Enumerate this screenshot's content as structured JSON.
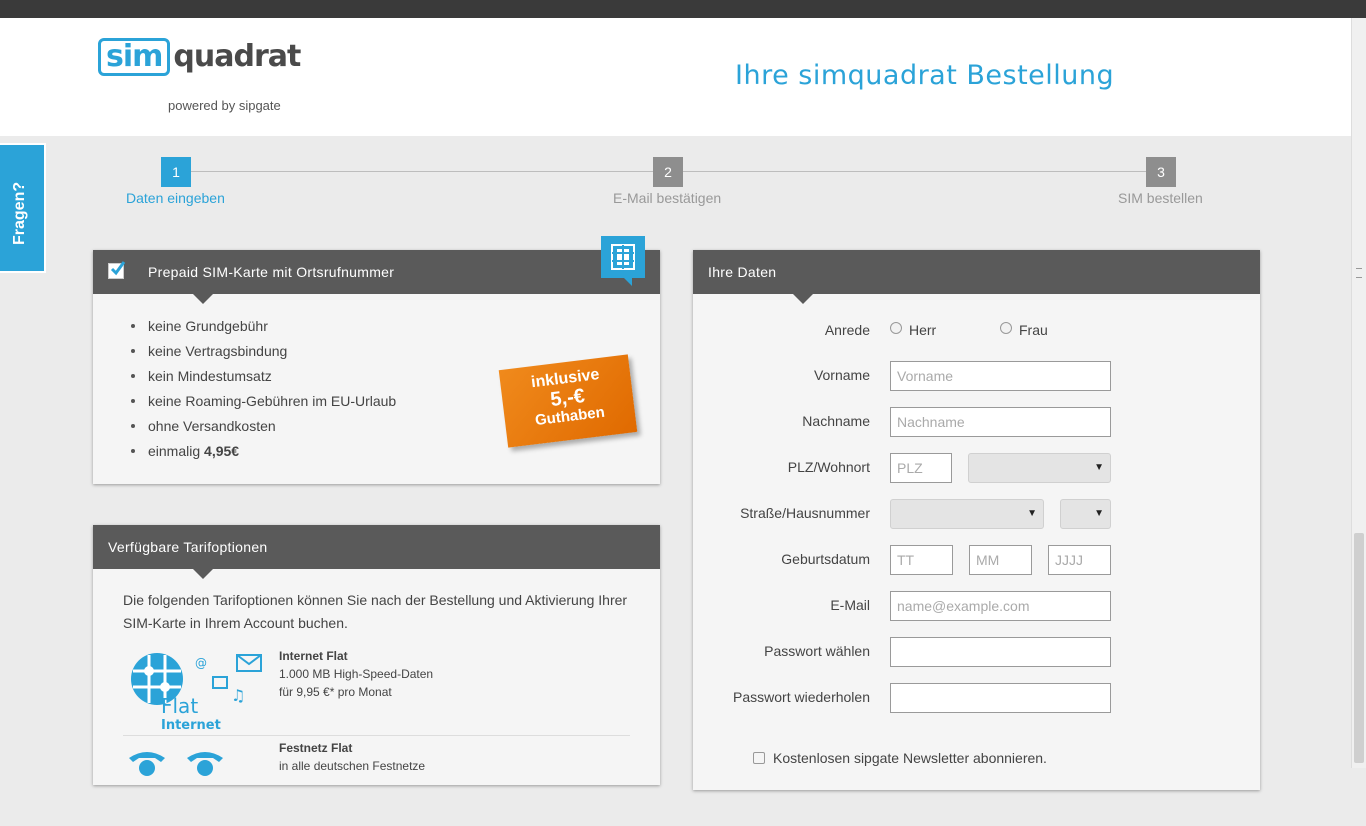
{
  "header": {
    "logo_box": "sim",
    "logo_rest": "quadrat",
    "logo_sub": "powered by sipgate",
    "title": "Ihre simquadrat Bestellung"
  },
  "fragen_tab": "Fragen?",
  "steps": [
    {
      "num": "1",
      "label": "Daten eingeben",
      "active": true
    },
    {
      "num": "2",
      "label": "E-Mail bestätigen",
      "active": false
    },
    {
      "num": "3",
      "label": "SIM bestellen",
      "active": false
    }
  ],
  "sim_panel": {
    "title": "Prepaid SIM-Karte mit Ortsrufnummer",
    "features": [
      "keine Grundgebühr",
      "keine Vertragsbindung",
      "kein Mindestumsatz",
      "keine Roaming-Gebühren im EU-Urlaub",
      "ohne Versandkosten"
    ],
    "price_prefix": "einmalig ",
    "price": "4,95€",
    "badge": {
      "line1": "inklusive",
      "line2": "5,-€",
      "line3": "Guthaben"
    }
  },
  "tarif_panel": {
    "title": "Verfügbare Tarifoptionen",
    "intro": "Die folgenden Tarifoptionen können Sie nach der Bestellung und Aktivierung Ihrer SIM-Karte in Ihrem Account buchen.",
    "options": [
      {
        "name": "Internet Flat",
        "line2": "1.000 MB High-Speed-Daten",
        "line3": "für 9,95 €* pro Monat",
        "icon_text1": "Flat",
        "icon_text2": "Internet"
      },
      {
        "name": "Festnetz Flat",
        "line2": "in alle deutschen Festnetze",
        "line3": ""
      }
    ]
  },
  "form_panel": {
    "title": "Ihre Daten",
    "anrede_label": "Anrede",
    "herr": "Herr",
    "frau": "Frau",
    "vorname_label": "Vorname",
    "vorname_ph": "Vorname",
    "nachname_label": "Nachname",
    "nachname_ph": "Nachname",
    "plz_label": "PLZ/Wohnort",
    "plz_ph": "PLZ",
    "strasse_label": "Straße/Hausnummer",
    "geburt_label": "Geburtsdatum",
    "tt_ph": "TT",
    "mm_ph": "MM",
    "jjjj_ph": "JJJJ",
    "email_label": "E-Mail",
    "email_ph": "name@example.com",
    "pw_label": "Passwort wählen",
    "pw2_label": "Passwort wiederholen",
    "newsletter": "Kostenlosen sipgate Newsletter abonnieren."
  },
  "colors": {
    "accent": "#2ba3d8",
    "dark_header": "#5a5a5a",
    "badge": "#ee7d12"
  }
}
